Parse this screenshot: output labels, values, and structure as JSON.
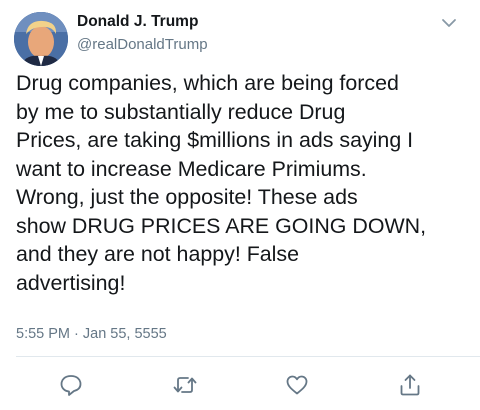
{
  "user": {
    "display_name": "Donald J. Trump",
    "handle": "@realDonaldTrump"
  },
  "tweet": {
    "lines": [
      "Drug companies, which are being forced",
      "by me to substantially reduce Drug",
      "Prices, are taking $millions in ads saying I",
      "want to increase Medicare Primiums.",
      "Wrong, just the opposite! These ads",
      "show DRUG PRICES ARE GOING DOWN,",
      "and they are not happy! False",
      "advertising!"
    ],
    "timestamp": "5:55 PM · Jan 55, 5555"
  },
  "actions": {
    "reply_icon": "reply-icon",
    "retweet_icon": "retweet-icon",
    "like_icon": "heart-icon",
    "share_icon": "share-icon"
  },
  "colors": {
    "text": "#14171a",
    "secondary": "#657786",
    "icon": "#657786",
    "divider": "#e1e8ed"
  }
}
